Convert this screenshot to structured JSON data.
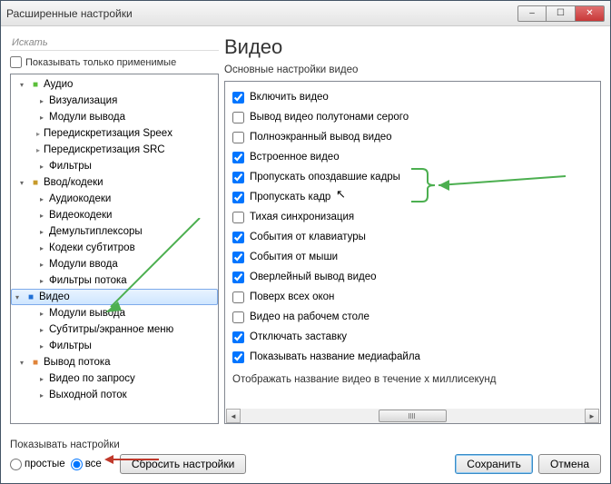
{
  "titlebar": {
    "title": "Расширенные настройки"
  },
  "left": {
    "search_placeholder": "Искать",
    "only_applicable": "Показывать только применимые",
    "tree": {
      "audio": "Аудио",
      "audio_children": [
        "Визуализация",
        "Модули вывода",
        "Передискретизация Speex",
        "Передискретизация SRC",
        "Фильтры"
      ],
      "input": "Ввод/кодеки",
      "input_children": [
        "Аудиокодеки",
        "Видеокодеки",
        "Демультиплексоры",
        "Кодеки субтитров",
        "Модули ввода",
        "Фильтры потока"
      ],
      "video": "Видео",
      "video_children": [
        "Модули вывода",
        "Субтитры/экранное меню",
        "Фильтры"
      ],
      "output": "Вывод потока",
      "output_children": [
        "Видео по запросу",
        "Выходной поток"
      ]
    }
  },
  "right": {
    "title": "Видео",
    "subtitle": "Основные настройки видео",
    "checks": [
      {
        "label": "Включить видео",
        "checked": true
      },
      {
        "label": "Вывод видео полутонами серого",
        "checked": false
      },
      {
        "label": "Полноэкранный вывод видео",
        "checked": false
      },
      {
        "label": "Встроенное видео",
        "checked": true
      },
      {
        "label": "Пропускать опоздавшие кадры",
        "checked": true
      },
      {
        "label": "Пропускать кадр",
        "checked": true
      },
      {
        "label": "Тихая синхронизация",
        "checked": false
      },
      {
        "label": "События от клавиатуры",
        "checked": true
      },
      {
        "label": "События от мыши",
        "checked": true
      },
      {
        "label": "Оверлейный вывод видео",
        "checked": true
      },
      {
        "label": "Поверх всех окон",
        "checked": false
      },
      {
        "label": "Видео на рабочем столе",
        "checked": false
      },
      {
        "label": "Отключать заставку",
        "checked": true
      },
      {
        "label": "Показывать название медиафайла",
        "checked": true
      }
    ],
    "hint": "Отображать название видео в течение x миллисекунд"
  },
  "footer": {
    "title": "Показывать настройки",
    "radio_simple": "простые",
    "radio_all": "все",
    "reset": "Сбросить настройки",
    "save": "Сохранить",
    "cancel": "Отмена"
  }
}
